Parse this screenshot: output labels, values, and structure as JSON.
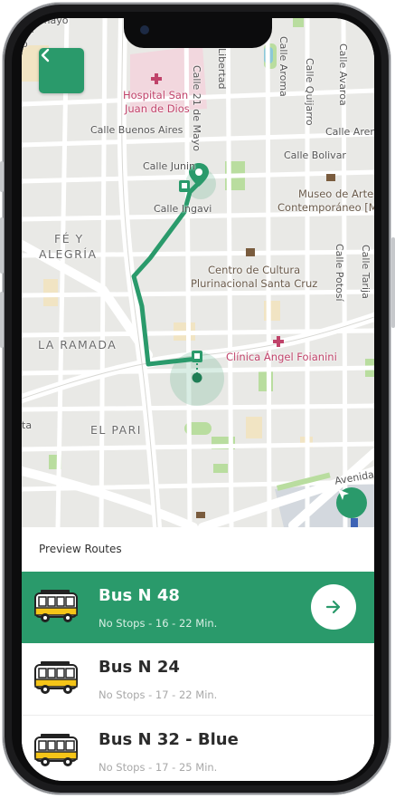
{
  "map": {
    "back_icon": "chevron-left-icon",
    "locate_icon": "navigation-arrow-icon",
    "streets": {
      "buenos_aires": "Calle Buenos Aires",
      "junin": "Calle Junin",
      "ingavi": "Calle Ingavi",
      "bolivar": "Calle Bolivar",
      "aroma": "Calle Aroma",
      "quijarro": "Calle Quijarro",
      "avaroa": "Calle Avaroa",
      "arenales": "Calle Aren",
      "potosi": "Calle Potosí",
      "tarija": "Calle Tarija",
      "libertad": "Libertad",
      "veintiuno_mayo": "Calle 21 de Mayo",
      "avenida": "Avenida A"
    },
    "places": {
      "hospital": "Hospital San Juan de Dios",
      "hospital_line1": "Hospital San",
      "hospital_line2": "Juan de Dios",
      "museo_line1": "Museo de Arte",
      "museo_line2": "Contemporáneo [MA",
      "centro_line1": "Centro de Cultura",
      "centro_line2": "Plurinacional Santa Cruz",
      "clinica": "Clínica Ángel Foianini",
      "fe_line1": "FÉ Y",
      "fe_line2": "ALEGRÍA",
      "la_ramada": "LA RAMADA",
      "el_pari": "EL PARI",
      "top_left": "amayo",
      "left_fragment": "na",
      "left_fragment2": "o",
      "left_ta": "ta"
    }
  },
  "sheet": {
    "title": "Preview Routes",
    "go_icon": "arrow-right-icon",
    "routes": [
      {
        "name": "Bus N 48",
        "meta": "No Stops - 16 - 22 Min.",
        "active": true
      },
      {
        "name": "Bus N 24",
        "meta": "No Stops - 17 - 22 Min.",
        "active": false
      },
      {
        "name": "Bus N 32 - Blue",
        "meta": "No Stops - 17 - 25 Min.",
        "active": false
      }
    ]
  },
  "colors": {
    "accent": "#2a9a6b",
    "route_line": "#2a9a6b",
    "map_bg": "#e9e9e6",
    "poi_pink": "#c0436a"
  }
}
